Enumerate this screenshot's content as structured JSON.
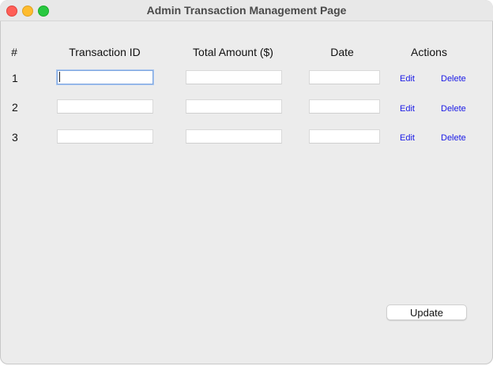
{
  "window": {
    "title": "Admin Transaction Management Page"
  },
  "table": {
    "headers": {
      "num": "#",
      "transaction_id": "Transaction ID",
      "total_amount": "Total Amount ($)",
      "date": "Date",
      "actions": "Actions"
    },
    "rows": [
      {
        "num": "1",
        "transaction_id": "",
        "total_amount": "",
        "date": "",
        "edit": "Edit",
        "delete": "Delete"
      },
      {
        "num": "2",
        "transaction_id": "",
        "total_amount": "",
        "date": "",
        "edit": "Edit",
        "delete": "Delete"
      },
      {
        "num": "3",
        "transaction_id": "",
        "total_amount": "",
        "date": "",
        "edit": "Edit",
        "delete": "Delete"
      }
    ]
  },
  "footer": {
    "update_label": "Update"
  }
}
